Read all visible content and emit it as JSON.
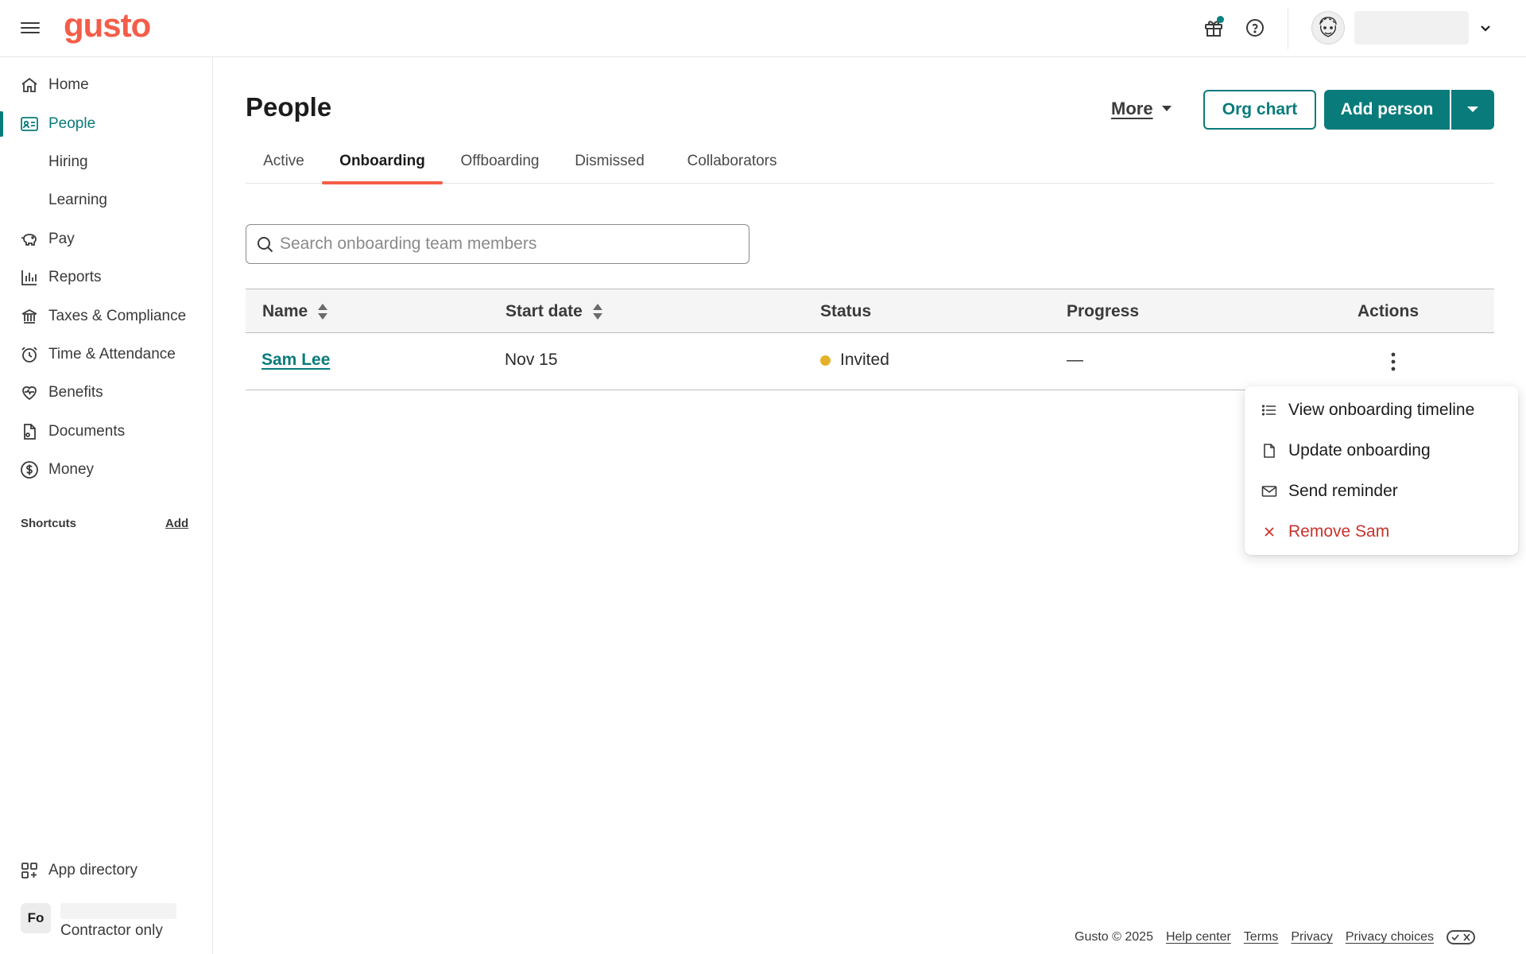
{
  "app": {
    "logo": "gusto"
  },
  "topbar": {
    "user_name": "",
    "colors": {
      "brand": "#f45d48",
      "accent": "#0a7b7b",
      "notification_dot": "#0a8080"
    }
  },
  "sidebar": {
    "items": [
      {
        "label": "Home",
        "icon": "home-icon"
      },
      {
        "label": "People",
        "icon": "id-card-icon",
        "active": true
      },
      {
        "label": "Hiring",
        "sub": true
      },
      {
        "label": "Learning",
        "sub": true
      },
      {
        "label": "Pay",
        "icon": "piggy-bank-icon"
      },
      {
        "label": "Reports",
        "icon": "bar-chart-icon"
      },
      {
        "label": "Taxes & Compliance",
        "icon": "bank-icon"
      },
      {
        "label": "Time & Attendance",
        "icon": "alarm-clock-icon"
      },
      {
        "label": "Benefits",
        "icon": "heart-icon"
      },
      {
        "label": "Documents",
        "icon": "document-icon"
      },
      {
        "label": "Money",
        "icon": "dollar-circle-icon"
      }
    ],
    "shortcuts_label": "Shortcuts",
    "shortcuts_add": "Add",
    "app_directory": "App directory",
    "company_initials": "Fo",
    "company_subtitle": "Contractor only"
  },
  "main": {
    "title": "People",
    "more_label": "More",
    "org_chart_label": "Org chart",
    "add_person_label": "Add person",
    "tabs": [
      {
        "label": "Active"
      },
      {
        "label": "Onboarding",
        "active": true
      },
      {
        "label": "Offboarding"
      },
      {
        "label": "Dismissed"
      },
      {
        "label": "Collaborators"
      }
    ],
    "search": {
      "placeholder": "Search onboarding team members",
      "value": ""
    },
    "table": {
      "columns": [
        "Name",
        "Start date",
        "Status",
        "Progress",
        "Actions"
      ],
      "rows": [
        {
          "name": "Sam Lee",
          "start_date": "Nov 15",
          "status": "Invited",
          "status_color": "#e4b12a",
          "progress": "—"
        }
      ]
    },
    "actions_menu": [
      {
        "label": "View onboarding timeline",
        "icon": "list-icon"
      },
      {
        "label": "Update onboarding",
        "icon": "document-icon"
      },
      {
        "label": "Send reminder",
        "icon": "envelope-icon"
      },
      {
        "label": "Remove Sam",
        "icon": "close-icon",
        "danger": true
      }
    ]
  },
  "footer": {
    "copyright": "Gusto © 2025",
    "links": [
      "Help center",
      "Terms",
      "Privacy",
      "Privacy choices"
    ]
  }
}
